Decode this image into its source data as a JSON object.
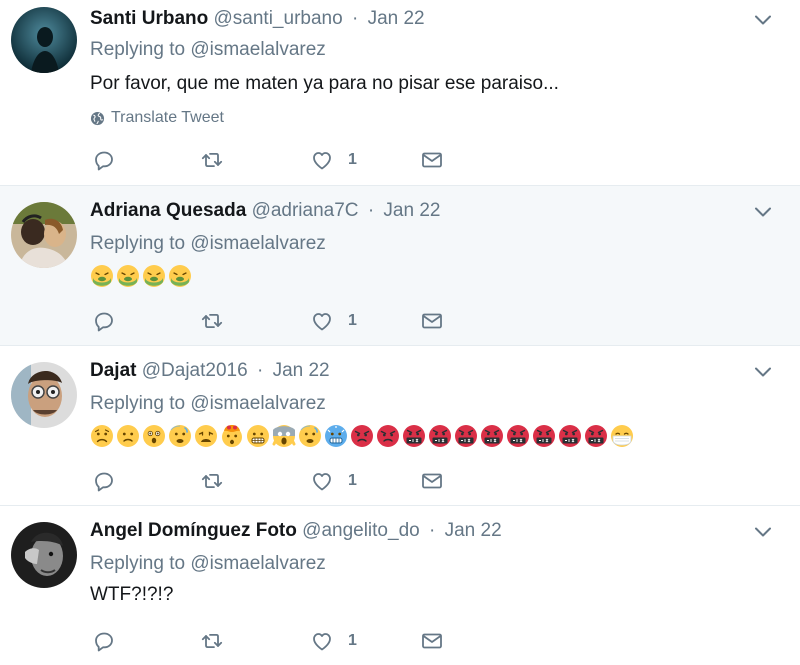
{
  "tweets": [
    {
      "name": "Santi Urbano",
      "handle": "@santi_urbano",
      "separator": "·",
      "date": "Jan 22",
      "replying_prefix": "Replying to",
      "replying_to": "@ismaelalvarez",
      "text": "Por favor, que me maten ya para no pisar ese paraiso...",
      "translate_label": "Translate Tweet",
      "like_count": "1",
      "avatar_icon": "avatar-santi-icon"
    },
    {
      "name": "Adriana Quesada",
      "handle": "@adriana7C",
      "separator": "·",
      "date": "Jan 22",
      "replying_prefix": "Replying to",
      "replying_to": "@ismaelalvarez",
      "emojis": [
        "nauseated-face",
        "nauseated-face",
        "nauseated-face",
        "nauseated-face"
      ],
      "like_count": "1",
      "avatar_icon": "avatar-adriana-icon"
    },
    {
      "name": "Dajat",
      "handle": "@Dajat2016",
      "separator": "·",
      "date": "Jan 22",
      "replying_prefix": "Replying to",
      "replying_to": "@ismaelalvarez",
      "emojis": [
        "worried-face",
        "frowning-face",
        "astonished-face",
        "anxious-face",
        "weary-face",
        "exploding-head",
        "grimacing-face",
        "screaming-face",
        "anxious-face",
        "cold-face",
        "angry-face",
        "angry-face",
        "cursing-face",
        "cursing-face",
        "cursing-face",
        "cursing-face",
        "cursing-face",
        "cursing-face",
        "cursing-face",
        "cursing-face",
        "mask-face"
      ],
      "like_count": "1",
      "avatar_icon": "avatar-dajat-icon"
    },
    {
      "name": "Angel Domínguez Foto",
      "handle": "@angelito_do",
      "separator": "·",
      "date": "Jan 22",
      "replying_prefix": "Replying to",
      "replying_to": "@ismaelalvarez",
      "text": "WTF?!?!?",
      "like_count": "1",
      "avatar_icon": "avatar-angel-icon"
    }
  ],
  "icons": {
    "reply": "reply-icon",
    "retweet": "retweet-icon",
    "like": "heart-icon",
    "dm": "envelope-icon",
    "caret": "chevron-down-icon",
    "globe": "globe-icon"
  },
  "colors": {
    "text": "#14171a",
    "secondary": "#657786",
    "divider": "#e6ecf0",
    "highlight_bg": "#f5f8fa"
  }
}
